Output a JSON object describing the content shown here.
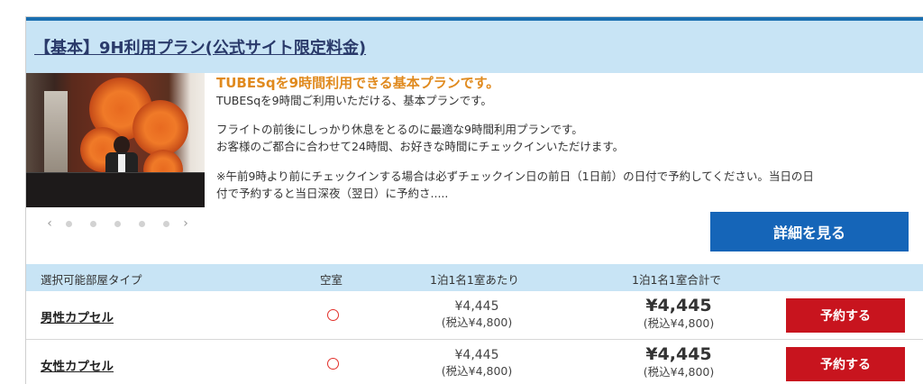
{
  "plan": {
    "title": "【基本】9H利用プラン(公式サイト限定料金)",
    "headline": "TUBESqを9時間利用できる基本プランです。",
    "lines": [
      "TUBESqを9時間ご利用いただける、基本プランです。",
      "フライトの前後にしっかり休息をとるのに最適な9時間利用プランです。",
      "お客様のご都合に合わせて24時間、お好きな時間にチェックインいただけます。",
      "※午前9時より前にチェックインする場合は必ずチェックイン日の前日（1日前）の日付で予約してください。当日の日",
      "付で予約すると当日深夜（翌日）に予約さ....."
    ],
    "detail_button": "詳細を見る"
  },
  "carousel": {
    "prev_icon": "‹",
    "next_icon": "›"
  },
  "table": {
    "headers": {
      "room_type": "選択可能部屋タイプ",
      "availability": "空室",
      "per_person": "1泊1名1室あたり",
      "total": "1泊1名1室合計で"
    },
    "rows": [
      {
        "room": "男性カプセル",
        "availability": "○",
        "price_per_person": "¥4,445",
        "price_per_person_tax": "(税込¥4,800)",
        "price_total": "¥4,445",
        "price_total_tax": "(税込¥4,800)",
        "book_label": "予約する"
      },
      {
        "room": "女性カプセル",
        "availability": "○",
        "price_per_person": "¥4,445",
        "price_per_person_tax": "(税込¥4,800)",
        "price_total": "¥4,445",
        "price_total_tax": "(税込¥4,800)",
        "book_label": "予約する"
      }
    ]
  },
  "colors": {
    "header_bg": "#c8e4f5",
    "accent_blue": "#1565b8",
    "headline_orange": "#e08a1e",
    "book_red": "#c8141e",
    "availability_red": "#e2302a"
  }
}
